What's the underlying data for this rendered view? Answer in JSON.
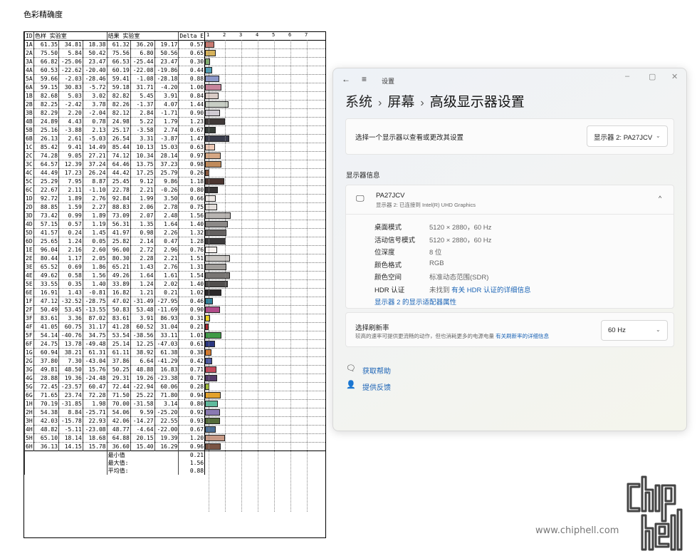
{
  "report": {
    "title": "色彩精确度",
    "headers": {
      "id": "ID",
      "lab_ref": "色样 实验室",
      "lab_meas": "结果 实验室",
      "delta": "Delta E"
    },
    "scale": [
      "1",
      "2",
      "3",
      "4",
      "5",
      "6",
      "7"
    ],
    "rows": [
      {
        "id": "1A",
        "r": [
          "61.35",
          "34.81",
          "18.38"
        ],
        "m": [
          "61.32",
          "36.20",
          "19.17"
        ],
        "de": "0.57",
        "color": "#c87970"
      },
      {
        "id": "2A",
        "r": [
          "75.50",
          "5.84",
          "50.42"
        ],
        "m": [
          "75.56",
          "6.80",
          "50.56"
        ],
        "de": "0.65",
        "color": "#d6b25a"
      },
      {
        "id": "3A",
        "r": [
          "66.82",
          "-25.06",
          "23.47"
        ],
        "m": [
          "66.53",
          "-25.44",
          "23.47"
        ],
        "de": "0.30",
        "color": "#7fac6c"
      },
      {
        "id": "4A",
        "r": [
          "60.53",
          "-22.62",
          "-20.40"
        ],
        "m": [
          "60.19",
          "-22.08",
          "-19.86"
        ],
        "de": "0.44",
        "color": "#4e9fb6"
      },
      {
        "id": "5A",
        "r": [
          "59.66",
          "-2.03",
          "-28.46"
        ],
        "m": [
          "59.41",
          "-1.08",
          "-28.18"
        ],
        "de": "0.88",
        "color": "#8a97c9"
      },
      {
        "id": "6A",
        "r": [
          "59.15",
          "30.83",
          "-5.72"
        ],
        "m": [
          "59.18",
          "31.71",
          "-4.20"
        ],
        "de": "1.00",
        "color": "#c8849c"
      },
      {
        "id": "1B",
        "r": [
          "82.68",
          "5.03",
          "3.02"
        ],
        "m": [
          "82.82",
          "5.45",
          "3.91"
        ],
        "de": "0.84",
        "color": "#d9cbc6"
      },
      {
        "id": "2B",
        "r": [
          "82.25",
          "-2.42",
          "3.78"
        ],
        "m": [
          "82.26",
          "-1.37",
          "4.07"
        ],
        "de": "1.44",
        "color": "#c8cec5"
      },
      {
        "id": "3B",
        "r": [
          "82.29",
          "2.20",
          "-2.04"
        ],
        "m": [
          "82.12",
          "2.84",
          "-1.71"
        ],
        "de": "0.90",
        "color": "#cfcad2"
      },
      {
        "id": "4B",
        "r": [
          "24.89",
          "4.43",
          "0.78"
        ],
        "m": [
          "24.98",
          "5.22",
          "1.79"
        ],
        "de": "1.23",
        "color": "#3f3938"
      },
      {
        "id": "5B",
        "r": [
          "25.16",
          "-3.88",
          "2.13"
        ],
        "m": [
          "25.17",
          "-3.58",
          "2.74"
        ],
        "de": "0.67",
        "color": "#363d38"
      },
      {
        "id": "6B",
        "r": [
          "26.13",
          "2.61",
          "-5.03"
        ],
        "m": [
          "26.54",
          "3.31",
          "-3.87"
        ],
        "de": "1.47",
        "color": "#3a3d4c"
      },
      {
        "id": "1C",
        "r": [
          "85.42",
          "9.41",
          "14.49"
        ],
        "m": [
          "85.44",
          "10.13",
          "15.03"
        ],
        "de": "0.63",
        "color": "#ecc8b6"
      },
      {
        "id": "2C",
        "r": [
          "74.28",
          "9.05",
          "27.21"
        ],
        "m": [
          "74.12",
          "10.34",
          "28.14"
        ],
        "de": "0.97",
        "color": "#d6a784"
      },
      {
        "id": "3C",
        "r": [
          "64.57",
          "12.39",
          "37.24"
        ],
        "m": [
          "64.46",
          "13.75",
          "37.23"
        ],
        "de": "0.98",
        "color": "#c08a5a"
      },
      {
        "id": "4C",
        "r": [
          "44.49",
          "17.23",
          "26.24"
        ],
        "m": [
          "44.42",
          "17.25",
          "25.79"
        ],
        "de": "0.26",
        "color": "#8a5a40"
      },
      {
        "id": "5C",
        "r": [
          "25.29",
          "7.95",
          "8.87"
        ],
        "m": [
          "25.45",
          "9.12",
          "9.86",
          "1.18"
        ],
        "de": "1.18",
        "color": "#4a3530"
      },
      {
        "id": "6C",
        "r": [
          "22.67",
          "2.11",
          "-1.10"
        ],
        "m": [
          "22.78",
          "2.21",
          "-0.26"
        ],
        "de": "0.80",
        "color": "#383536"
      },
      {
        "id": "1D",
        "r": [
          "92.72",
          "1.89",
          "2.76"
        ],
        "m": [
          "92.84",
          "1.99",
          "3.50"
        ],
        "de": "0.66",
        "color": "#eee9e6"
      },
      {
        "id": "2D",
        "r": [
          "88.85",
          "1.59",
          "2.27"
        ],
        "m": [
          "88.83",
          "2.06",
          "2.78"
        ],
        "de": "0.75",
        "color": "#e3dedb"
      },
      {
        "id": "3D",
        "r": [
          "73.42",
          "0.99",
          "1.89"
        ],
        "m": [
          "73.09",
          "2.07",
          "2.48",
          "1.56"
        ],
        "de": "1.56",
        "color": "#b8b4b1"
      },
      {
        "id": "4D",
        "r": [
          "57.15",
          "0.57",
          "1.19"
        ],
        "m": [
          "56.31",
          "1.35",
          "1.64"
        ],
        "de": "1.40",
        "color": "#8c8987"
      },
      {
        "id": "5D",
        "r": [
          "41.57",
          "0.24",
          "1.45"
        ],
        "m": [
          "41.97",
          "0.98",
          "2.26"
        ],
        "de": "1.32",
        "color": "#646160"
      },
      {
        "id": "6D",
        "r": [
          "25.65",
          "1.24",
          "0.05"
        ],
        "m": [
          "25.82",
          "2.14",
          "0.47"
        ],
        "de": "1.28",
        "color": "#3c3a3b"
      },
      {
        "id": "1E",
        "r": [
          "96.04",
          "2.16",
          "2.60"
        ],
        "m": [
          "96.00",
          "2.72",
          "2.96"
        ],
        "de": "0.76",
        "color": "#f7f2ef"
      },
      {
        "id": "2E",
        "r": [
          "80.44",
          "1.17",
          "2.05"
        ],
        "m": [
          "80.30",
          "2.28",
          "2.21"
        ],
        "de": "1.51",
        "color": "#cac7c4"
      },
      {
        "id": "3E",
        "r": [
          "65.52",
          "0.69",
          "1.86"
        ],
        "m": [
          "65.21",
          "1.43",
          "2.76"
        ],
        "de": "1.31",
        "color": "#a19e9b"
      },
      {
        "id": "4E",
        "r": [
          "49.62",
          "0.58",
          "1.56"
        ],
        "m": [
          "49.26",
          "1.64",
          "1.61"
        ],
        "de": "1.54",
        "color": "#787573"
      },
      {
        "id": "5E",
        "r": [
          "33.55",
          "0.35",
          "1.40"
        ],
        "m": [
          "33.89",
          "1.24",
          "2.02"
        ],
        "de": "1.40",
        "color": "#514f4e"
      },
      {
        "id": "6E",
        "r": [
          "16.91",
          "1.43",
          "-0.81"
        ],
        "m": [
          "16.82",
          "1.21",
          "0.21"
        ],
        "de": "1.02",
        "color": "#2a2829"
      },
      {
        "id": "1F",
        "r": [
          "47.12",
          "-32.52",
          "-28.75"
        ],
        "m": [
          "47.02",
          "-31.49",
          "-27.95"
        ],
        "de": "0.46",
        "color": "#2f7f99"
      },
      {
        "id": "2F",
        "r": [
          "50.49",
          "53.45",
          "-13.55"
        ],
        "m": [
          "50.83",
          "53.48",
          "-11.69"
        ],
        "de": "0.90",
        "color": "#b24c8a"
      },
      {
        "id": "3F",
        "r": [
          "83.61",
          "3.36",
          "87.02"
        ],
        "m": [
          "83.61",
          "3.91",
          "86.93"
        ],
        "de": "0.31",
        "color": "#ecd01c"
      },
      {
        "id": "4F",
        "r": [
          "41.05",
          "60.75",
          "31.17"
        ],
        "m": [
          "41.28",
          "60.52",
          "31.04"
        ],
        "de": "0.21",
        "color": "#b02b35"
      },
      {
        "id": "5F",
        "r": [
          "54.14",
          "-40.76",
          "34.75"
        ],
        "m": [
          "53.54",
          "-38.56",
          "33.11"
        ],
        "de": "1.01",
        "color": "#3f9a46"
      },
      {
        "id": "6F",
        "r": [
          "24.75",
          "13.78",
          "-49.48"
        ],
        "m": [
          "25.14",
          "12.25",
          "-47.03"
        ],
        "de": "0.61",
        "color": "#2a3680"
      },
      {
        "id": "1G",
        "r": [
          "60.94",
          "38.21",
          "61.31"
        ],
        "m": [
          "61.11",
          "38.92",
          "61.38"
        ],
        "de": "0.38",
        "color": "#d87a2a"
      },
      {
        "id": "2G",
        "r": [
          "37.80",
          "7.30",
          "-43.04"
        ],
        "m": [
          "37.86",
          "6.64",
          "-41.29"
        ],
        "de": "0.42",
        "color": "#4a57a0"
      },
      {
        "id": "3G",
        "r": [
          "49.81",
          "48.50",
          "15.76"
        ],
        "m": [
          "50.25",
          "48.88",
          "16.83"
        ],
        "de": "0.71",
        "color": "#c34a5c"
      },
      {
        "id": "4G",
        "r": [
          "28.88",
          "19.36",
          "-24.48"
        ],
        "m": [
          "29.31",
          "19.26",
          "-23.38"
        ],
        "de": "0.72",
        "color": "#553a6a"
      },
      {
        "id": "5G",
        "r": [
          "72.45",
          "-23.57",
          "60.47"
        ],
        "m": [
          "72.44",
          "-22.94",
          "60.06"
        ],
        "de": "0.28",
        "color": "#9fbb3a"
      },
      {
        "id": "6G",
        "r": [
          "71.65",
          "23.74",
          "72.28"
        ],
        "m": [
          "71.50",
          "25.22",
          "71.80"
        ],
        "de": "0.94",
        "color": "#e3a22a"
      },
      {
        "id": "1H",
        "r": [
          "70.19",
          "-31.85",
          "1.98"
        ],
        "m": [
          "70.00",
          "-31.58",
          "3.14"
        ],
        "de": "0.80",
        "color": "#5fbb9d"
      },
      {
        "id": "2H",
        "r": [
          "54.38",
          "8.84",
          "-25.71"
        ],
        "m": [
          "54.06",
          "9.59",
          "-25.20"
        ],
        "de": "0.92",
        "color": "#8a79b2"
      },
      {
        "id": "3H",
        "r": [
          "42.03",
          "-15.78",
          "22.93"
        ],
        "m": [
          "42.06",
          "-14.27",
          "22.55"
        ],
        "de": "0.93",
        "color": "#546b3a"
      },
      {
        "id": "4H",
        "r": [
          "48.82",
          "-5.11",
          "-23.08"
        ],
        "m": [
          "48.77",
          "-4.64",
          "-22.00"
        ],
        "de": "0.67",
        "color": "#4c6f95"
      },
      {
        "id": "5H",
        "r": [
          "65.10",
          "18.14",
          "18.68"
        ],
        "m": [
          "64.88",
          "20.15",
          "19.39"
        ],
        "de": "1.20",
        "color": "#c79a86"
      },
      {
        "id": "6H",
        "r": [
          "36.13",
          "14.15",
          "15.78"
        ],
        "m": [
          "36.60",
          "15.40",
          "16.29"
        ],
        "de": "0.96",
        "color": "#7a5444"
      }
    ],
    "summary": [
      {
        "label": "最小值",
        "value": "0.21"
      },
      {
        "label": "最大值:",
        "value": "1.56"
      },
      {
        "label": "平均值:",
        "value": "0.88"
      }
    ]
  },
  "window": {
    "app_title": "设置",
    "back_icon": "←",
    "menu_icon": "≡",
    "controls": {
      "min": "–",
      "max": "▢",
      "close": "✕"
    },
    "breadcrumb": [
      "系统",
      "屏幕",
      "高级显示器设置"
    ],
    "select_display": {
      "label": "选择一个显示器以查看或更改其设置",
      "value": "显示器 2: PA27JCV"
    },
    "section_title": "显示器信息",
    "monitor": {
      "name": "PA27JCV",
      "desc": "显示器 2: 已连接到 Intel(R) UHD Graphics"
    },
    "properties": [
      {
        "k": "桌面模式",
        "v": "5120 × 2880，60 Hz"
      },
      {
        "k": "活动信号模式",
        "v": "5120 × 2880，60 Hz"
      },
      {
        "k": "位深度",
        "v": "8 位"
      },
      {
        "k": "颜色格式",
        "v": "RGB"
      },
      {
        "k": "颜色空间",
        "v": "标准动态范围(SDR)"
      },
      {
        "k": "HDR 认证",
        "v": "未找到",
        "link": "有关 HDR 认证的详细信息"
      }
    ],
    "adapter_link": "显示器 2 的显示适配器属性",
    "refresh": {
      "title": "选择刷新率",
      "desc": "较高的速率可提供更流畅的动作，但也消耗更多的电源电量",
      "link": "有关刷新率的详细信息",
      "value": "60 Hz"
    },
    "help": "获取帮助",
    "feedback": "提供反馈"
  },
  "watermark": "www.chiphell.com",
  "logo_text": "chip hell"
}
